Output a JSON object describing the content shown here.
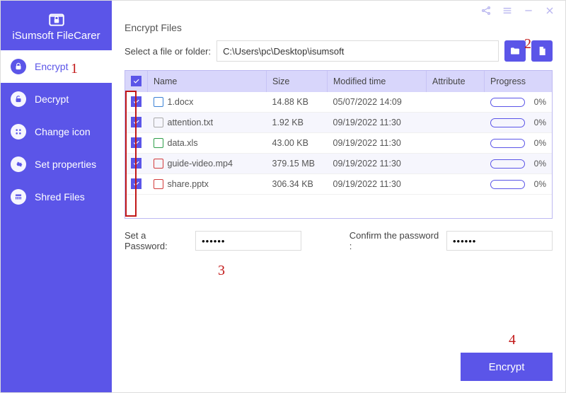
{
  "app": {
    "title": "iSumsoft FileCarer"
  },
  "sidebar": {
    "items": [
      {
        "label": "Encrypt",
        "active": true
      },
      {
        "label": "Decrypt"
      },
      {
        "label": "Change icon"
      },
      {
        "label": "Set properties"
      },
      {
        "label": "Shred Files"
      }
    ]
  },
  "section": {
    "title": "Encrypt Files",
    "path_label": "Select a file or folder:",
    "path_value": "C:\\Users\\pc\\Desktop\\isumsoft"
  },
  "table": {
    "headers": {
      "name": "Name",
      "size": "Size",
      "modified": "Modified time",
      "attribute": "Attribute",
      "progress": "Progress"
    },
    "rows": [
      {
        "name": "1.docx",
        "icon": "docx",
        "size": "14.88 KB",
        "modified": "05/07/2022 14:09",
        "attribute": "",
        "progress": "0%"
      },
      {
        "name": "attention.txt",
        "icon": "txt",
        "size": "1.92 KB",
        "modified": "09/19/2022 11:30",
        "attribute": "",
        "progress": "0%"
      },
      {
        "name": "data.xls",
        "icon": "xls",
        "size": "43.00 KB",
        "modified": "09/19/2022 11:30",
        "attribute": "",
        "progress": "0%"
      },
      {
        "name": "guide-video.mp4",
        "icon": "mp4",
        "size": "379.15 MB",
        "modified": "09/19/2022 11:30",
        "attribute": "",
        "progress": "0%"
      },
      {
        "name": "share.pptx",
        "icon": "pptx",
        "size": "306.34 KB",
        "modified": "09/19/2022 11:30",
        "attribute": "",
        "progress": "0%"
      }
    ]
  },
  "password": {
    "set_label": "Set a Password:",
    "confirm_label": "Confirm the password :",
    "set_value": "••••••",
    "confirm_value": "••••••"
  },
  "footer": {
    "encrypt_label": "Encrypt"
  },
  "annotations": {
    "a1": "1",
    "a2": "2",
    "a3": "3",
    "a4": "4"
  }
}
